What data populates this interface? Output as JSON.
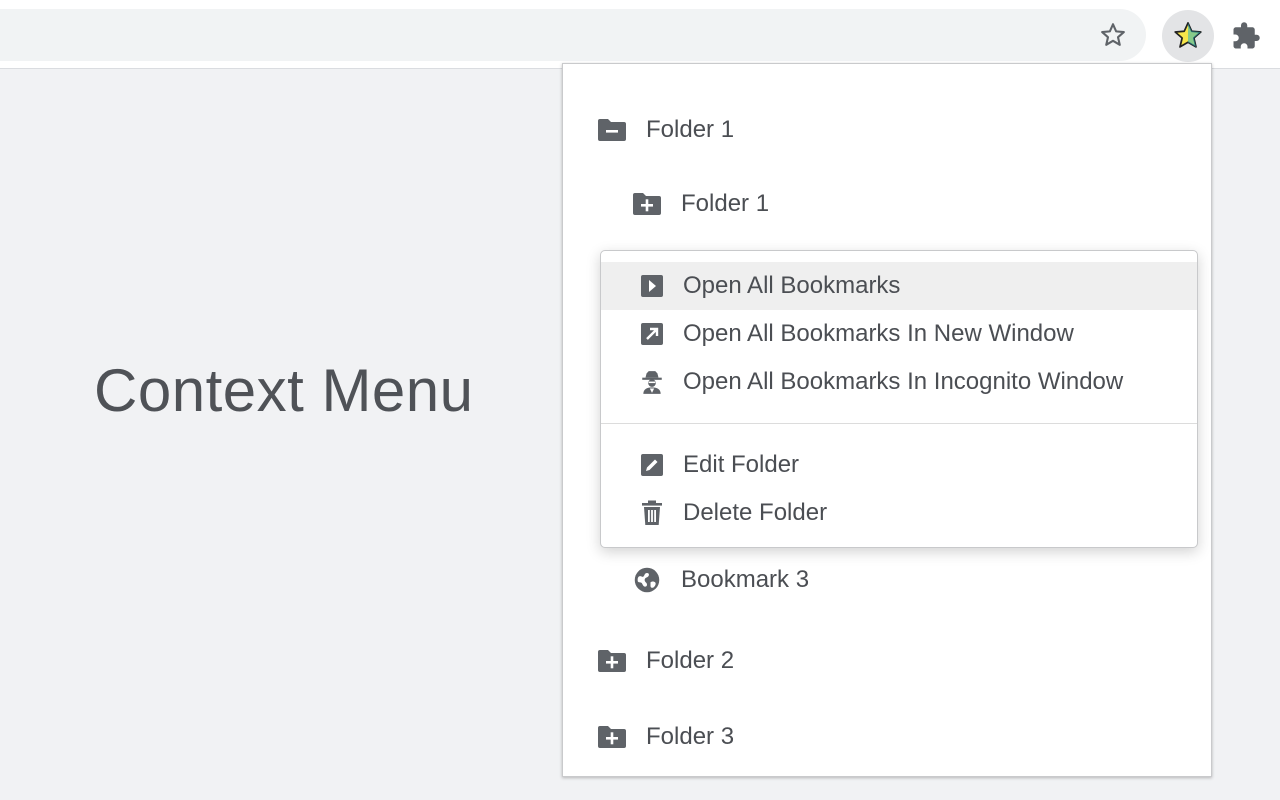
{
  "page": {
    "title": "Context Menu"
  },
  "toolbar": {
    "bookmark_star_icon": "star-outline-icon",
    "extension_icon": "yellow-star-extension-icon",
    "extensions_icon": "puzzle-icon"
  },
  "tree": {
    "items": [
      {
        "label": "Folder 1",
        "icon": "folder-minus-icon",
        "depth": 0
      },
      {
        "label": "Folder 1",
        "icon": "folder-plus-icon",
        "depth": 1
      },
      {
        "label": "Bookmark 3",
        "icon": "globe-icon",
        "depth": 1
      },
      {
        "label": "Folder 2",
        "icon": "folder-plus-icon",
        "depth": 0
      },
      {
        "label": "Folder 3",
        "icon": "folder-plus-icon",
        "depth": 0
      }
    ]
  },
  "context_menu": {
    "items": [
      {
        "label": "Open All Bookmarks",
        "icon": "play-box-icon",
        "highlighted": true
      },
      {
        "label": "Open All Bookmarks In New Window",
        "icon": "open-new-window-icon"
      },
      {
        "label": "Open All Bookmarks In Incognito Window",
        "icon": "incognito-icon"
      },
      {
        "label": "Edit Folder",
        "icon": "edit-icon"
      },
      {
        "label": "Delete Folder",
        "icon": "trash-icon"
      }
    ]
  },
  "colors": {
    "background": "#f1f2f4",
    "text": "#4b4e53",
    "icon": "#5f6368",
    "highlight": "#efefef",
    "extension_star_fill": "#f7e64a",
    "extension_star_accent": "#2bb3c0"
  }
}
